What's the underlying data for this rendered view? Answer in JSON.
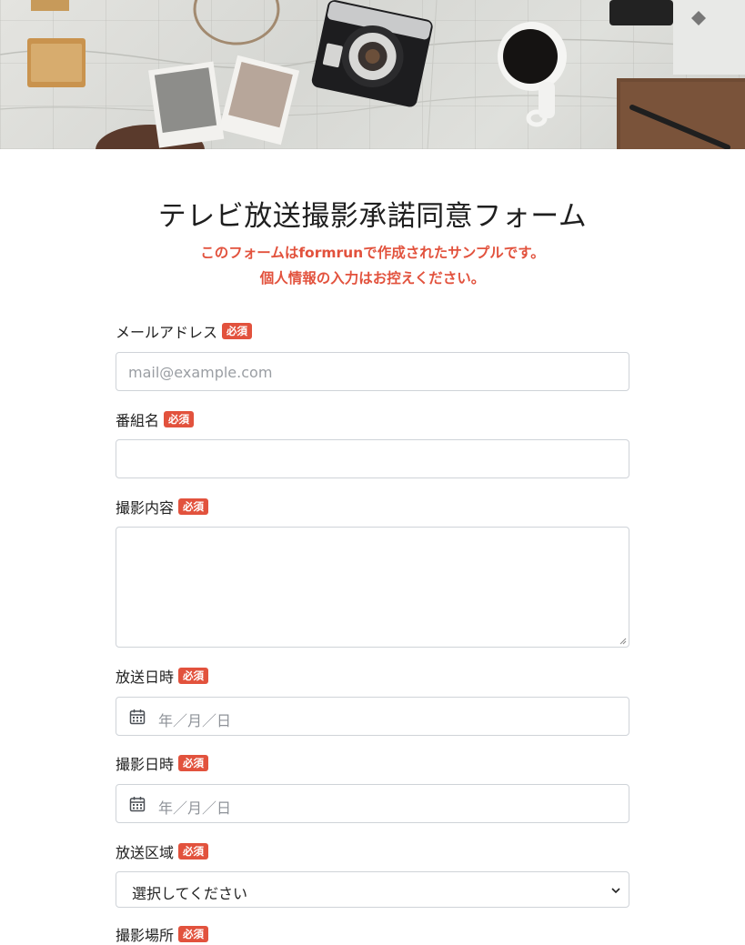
{
  "form": {
    "title": "テレビ放送撮影承諾同意フォーム",
    "notice_line1": "このフォームはformrunで作成されたサンプルです。",
    "notice_line2": "個人情報の入力はお控えください。",
    "required_badge": "必須",
    "fields": [
      {
        "label": "メールアドレス",
        "type": "email",
        "placeholder": "mail@example.com"
      },
      {
        "label": "番組名",
        "type": "text",
        "placeholder": ""
      },
      {
        "label": "撮影内容",
        "type": "textarea",
        "placeholder": ""
      },
      {
        "label": "放送日時",
        "type": "date",
        "placeholder": "年／月／日"
      },
      {
        "label": "撮影日時",
        "type": "date",
        "placeholder": "年／月／日"
      },
      {
        "label": "放送区域",
        "type": "select",
        "value": "選択してください"
      },
      {
        "label": "撮影場所",
        "type": "text",
        "placeholder": ""
      }
    ]
  },
  "colors": {
    "accent": "#e2523d",
    "border": "#cfd3d8",
    "placeholder": "#9a9ea3"
  },
  "icons": {
    "date": "calendar-icon",
    "select": "chevron-down-icon"
  }
}
